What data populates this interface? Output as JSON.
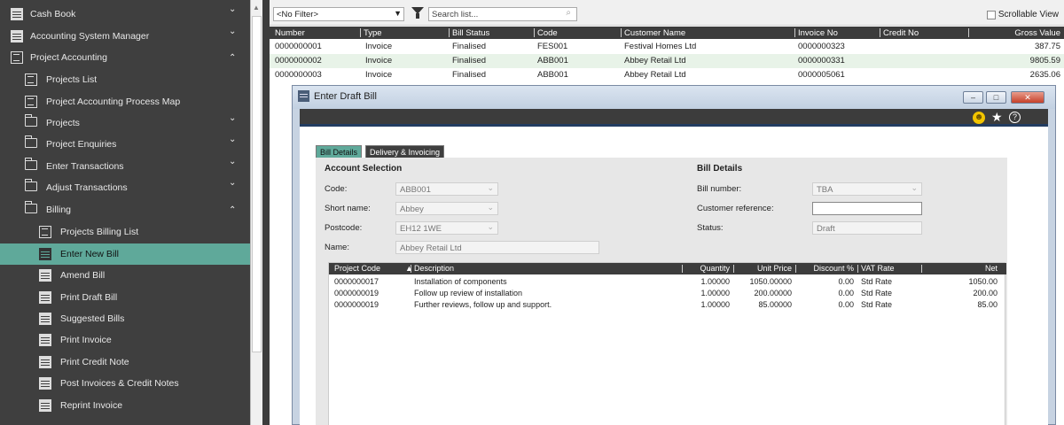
{
  "sidebar": {
    "items": [
      {
        "label": "Cash Book",
        "icon": "bank-icon",
        "chevron": "⌄"
      },
      {
        "label": "Accounting System Manager",
        "icon": "manager-icon",
        "chevron": "⌄"
      },
      {
        "label": "Project Accounting",
        "icon": "clipboard-icon",
        "chevron": "⌃"
      },
      {
        "label": "Projects List",
        "icon": "list-icon",
        "chevron": ""
      },
      {
        "label": "Project Accounting Process Map",
        "icon": "process-map-icon",
        "chevron": ""
      },
      {
        "label": "Projects",
        "icon": "folder-icon",
        "chevron": "⌄"
      },
      {
        "label": "Project Enquiries",
        "icon": "folder-icon",
        "chevron": "⌄"
      },
      {
        "label": "Enter Transactions",
        "icon": "folder-icon",
        "chevron": "⌄"
      },
      {
        "label": "Adjust Transactions",
        "icon": "folder-icon",
        "chevron": "⌄"
      },
      {
        "label": "Billing",
        "icon": "folder-icon",
        "chevron": "⌃"
      },
      {
        "label": "Projects Billing List",
        "icon": "list-icon",
        "chevron": ""
      },
      {
        "label": "Enter New Bill",
        "icon": "form-icon",
        "chevron": ""
      },
      {
        "label": "Amend Bill",
        "icon": "form-icon",
        "chevron": ""
      },
      {
        "label": "Print Draft Bill",
        "icon": "form-icon",
        "chevron": ""
      },
      {
        "label": "Suggested Bills",
        "icon": "form-icon",
        "chevron": ""
      },
      {
        "label": "Print Invoice",
        "icon": "form-icon",
        "chevron": ""
      },
      {
        "label": "Print Credit Note",
        "icon": "form-icon",
        "chevron": ""
      },
      {
        "label": "Post Invoices & Credit Notes",
        "icon": "form-icon",
        "chevron": ""
      },
      {
        "label": "Reprint Invoice",
        "icon": "form-icon",
        "chevron": ""
      }
    ],
    "active_label": "Enter New Bill",
    "active_color": "#5fa99a"
  },
  "toolbar": {
    "filter_value": "<No Filter>",
    "search_placeholder": "Search list...",
    "scrollable_label": "Scrollable View"
  },
  "list": {
    "columns": [
      "Number",
      "Type",
      "Bill Status",
      "Code",
      "Customer Name",
      "Invoice No",
      "Credit No",
      "Gross Value"
    ],
    "rows": [
      [
        "0000000001",
        "Invoice",
        "Finalised",
        "FES001",
        "Festival Homes Ltd",
        "0000000323",
        "",
        "387.75"
      ],
      [
        "0000000002",
        "Invoice",
        "Finalised",
        "ABB001",
        "Abbey Retail Ltd",
        "0000000331",
        "",
        "9805.59"
      ],
      [
        "0000000003",
        "Invoice",
        "Finalised",
        "ABB001",
        "Abbey Retail Ltd",
        "0000005061",
        "",
        "2635.06"
      ]
    ]
  },
  "modal": {
    "title": "Enter Draft Bill",
    "min_label": "–",
    "max_label": "□",
    "close_label": "✕",
    "tabs": [
      "Bill Details",
      "Delivery & Invoicing"
    ],
    "account_section": "Account Selection",
    "bill_section": "Bill Details",
    "fields": {
      "code_label": "Code:",
      "code_value": "ABB001",
      "short_label": "Short name:",
      "short_value": "Abbey",
      "postcode_label": "Postcode:",
      "postcode_value": "EH12 1WE",
      "name_label": "Name:",
      "name_value": "Abbey Retail Ltd",
      "billno_label": "Bill number:",
      "billno_value": "TBA",
      "custref_label": "Customer reference:",
      "custref_value": "",
      "status_label": "Status:",
      "status_value": "Draft"
    },
    "grid_columns": [
      "Project Code",
      "Description",
      "Quantity",
      "Unit Price",
      "Discount %",
      "VAT Rate",
      "Net"
    ],
    "grid_rows": [
      [
        "0000000017",
        "Installation of components",
        "1.00000",
        "1050.00000",
        "0.00",
        "Std Rate",
        "1050.00"
      ],
      [
        "0000000019",
        "Follow up review of installation",
        "1.00000",
        "200.00000",
        "0.00",
        "Std Rate",
        "200.00"
      ],
      [
        "0000000019",
        "Further reviews, follow up and support.",
        "1.00000",
        "85.00000",
        "0.00",
        "Std Rate",
        "85.00"
      ]
    ]
  }
}
